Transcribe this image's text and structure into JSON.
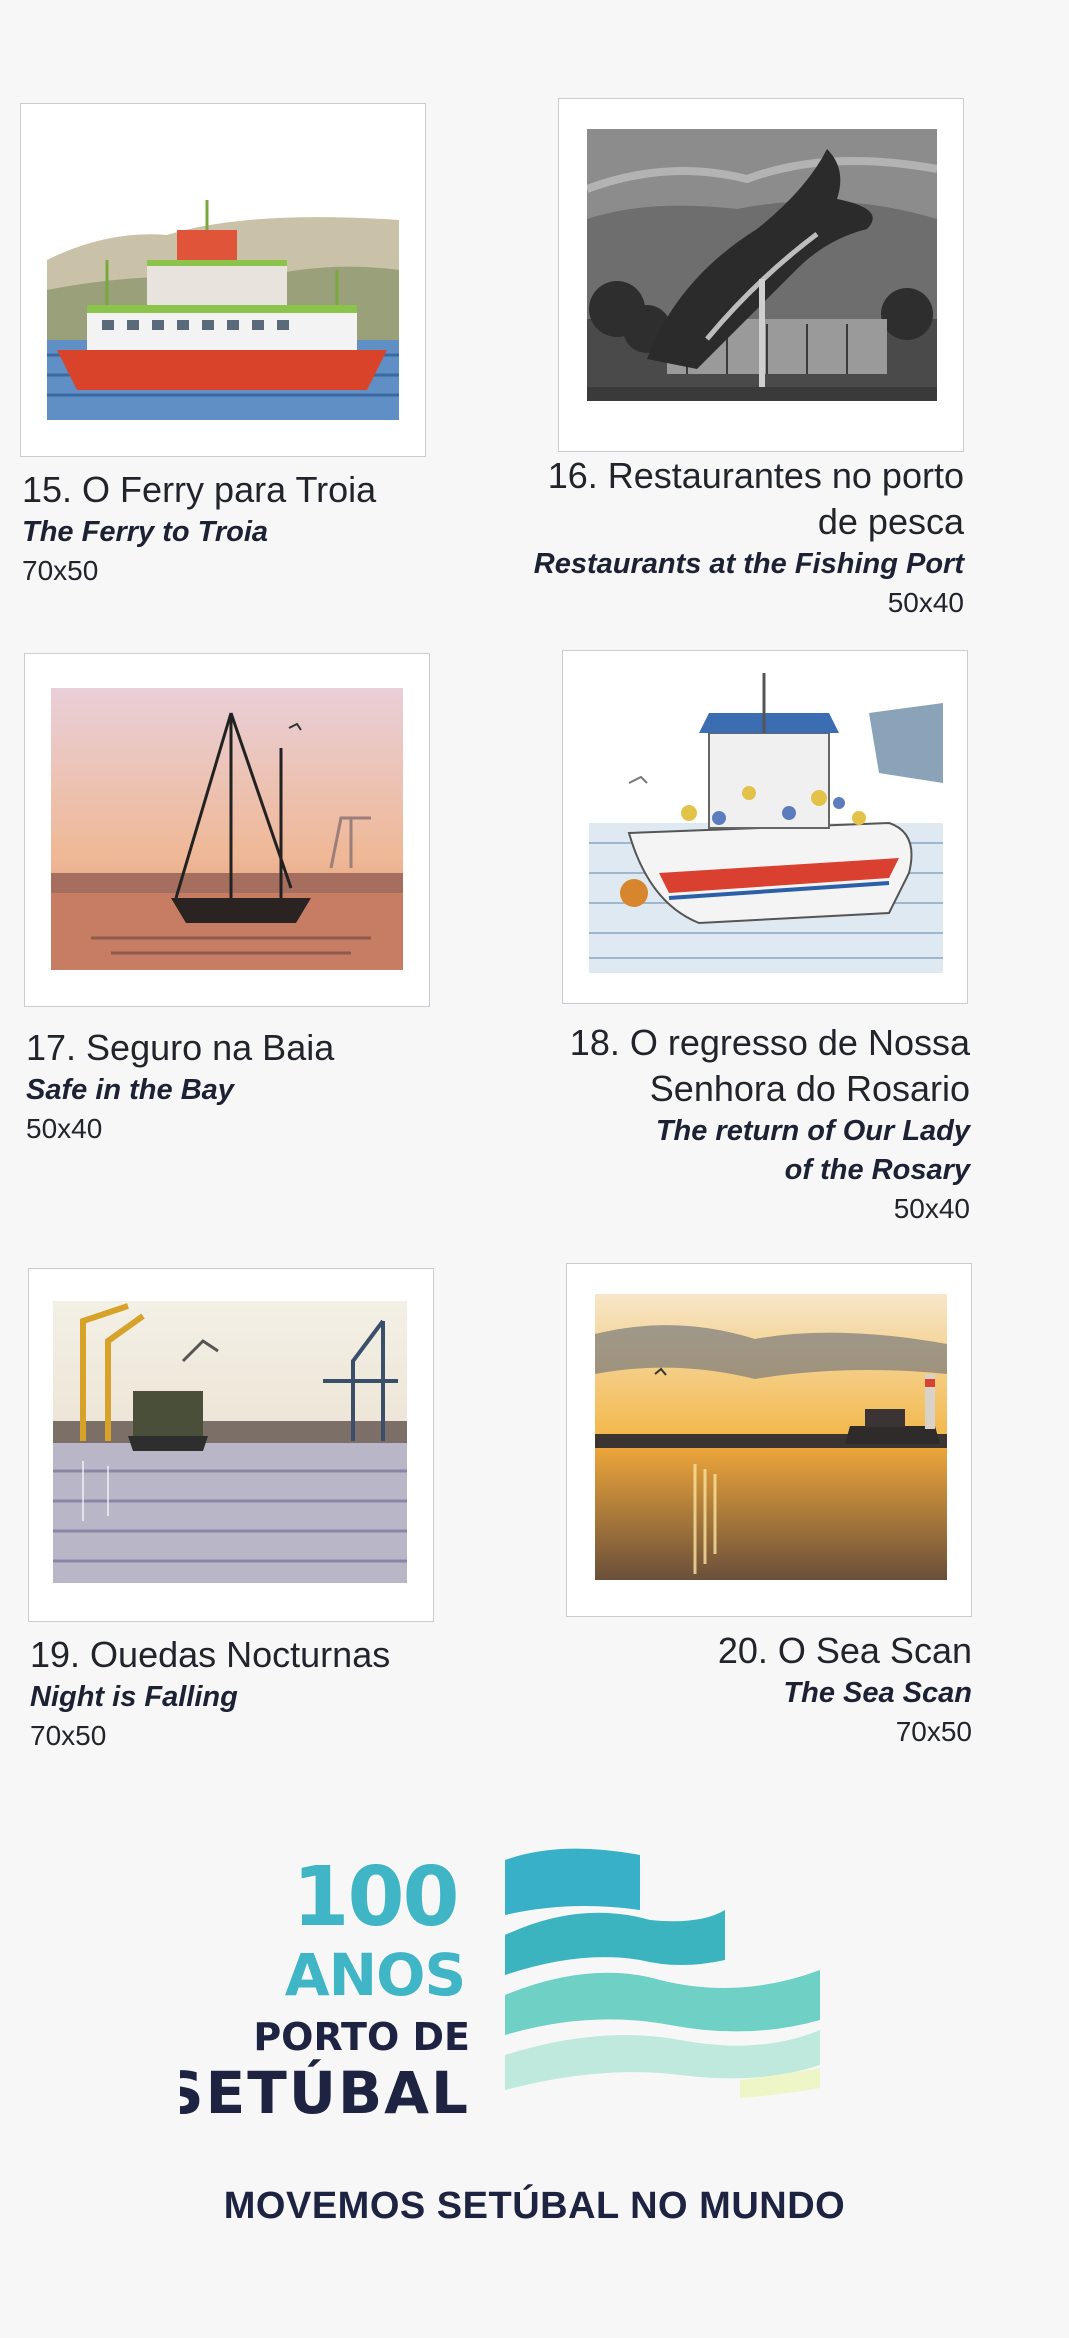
{
  "paintings": [
    {
      "number_title": "15. O Ferry para Troia",
      "english": "The Ferry to Troia",
      "size": "70x50",
      "image": "ferry-painting"
    },
    {
      "number_title_line1": "16. Restaurantes no porto",
      "number_title_line2": "de pesca",
      "english": "Restaurants at the Fishing Port",
      "size": "50x40",
      "image": "dolphin-statue-painting"
    },
    {
      "number_title": "17. Seguro na Baia",
      "english": "Safe in the Bay",
      "size": "50x40",
      "image": "sailboat-painting"
    },
    {
      "number_title_line1": "18. O regresso de Nossa",
      "number_title_line2": "Senhora do Rosario",
      "english_line1": "The return of Our Lady",
      "english_line2": "of the Rosary",
      "size": "50x40",
      "image": "procession-boat-painting"
    },
    {
      "number_title": "19. Ouedas Nocturnas",
      "english": "Night is Falling",
      "size": "70x50",
      "image": "port-cranes-painting"
    },
    {
      "number_title": "20. O Sea Scan",
      "english": "The Sea Scan",
      "size": "70x50",
      "image": "sunset-ship-painting"
    }
  ],
  "logo": {
    "line1": "100",
    "line2": "ANOS",
    "line3": "PORTO DE",
    "line4": "SETÚBAL",
    "colors": {
      "teal": "#3fb5c6",
      "navy": "#1d2340",
      "light": "#bfe9dc"
    }
  },
  "slogan": "MOVEMOS SETÚBAL NO MUNDO"
}
